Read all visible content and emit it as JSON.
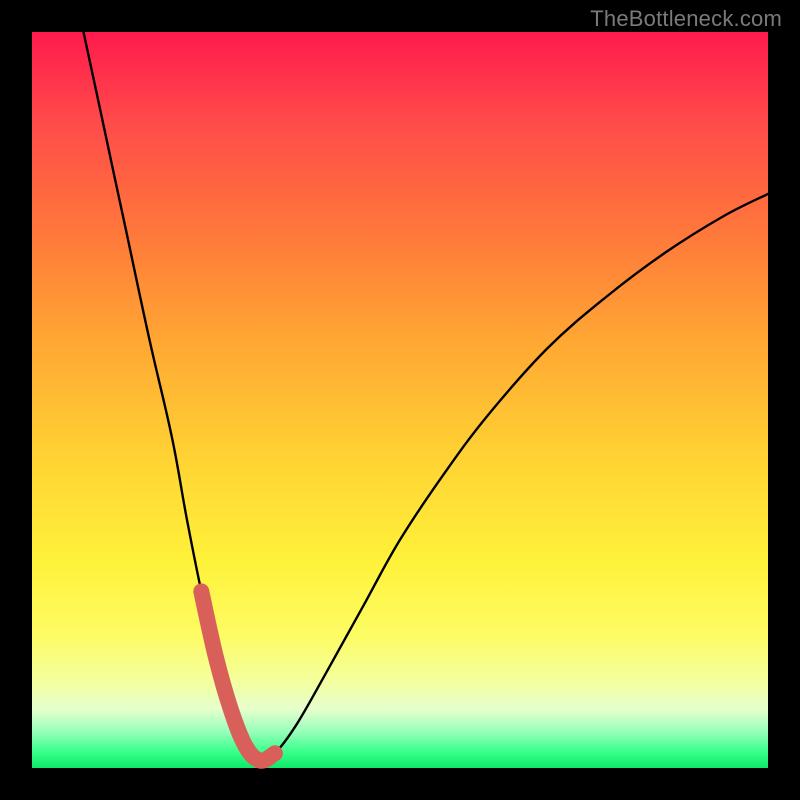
{
  "watermark": "TheBottleneck.com",
  "chart_data": {
    "type": "line",
    "title": "",
    "xlabel": "",
    "ylabel": "",
    "xlim": [
      0,
      100
    ],
    "ylim": [
      0,
      100
    ],
    "series": [
      {
        "name": "bottleneck-curve",
        "x": [
          7,
          10,
          13,
          16,
          19,
          21,
          23,
          25,
          27,
          29,
          31,
          33,
          36,
          40,
          45,
          50,
          56,
          62,
          70,
          78,
          86,
          94,
          100
        ],
        "values": [
          100,
          86,
          72,
          58,
          45,
          34,
          24,
          15,
          8,
          3,
          1,
          2,
          6,
          13,
          22,
          31,
          40,
          48,
          57,
          64,
          70,
          75,
          78
        ]
      },
      {
        "name": "highlight-segment",
        "x": [
          23,
          25,
          27,
          29,
          31,
          33
        ],
        "values": [
          24,
          15,
          8,
          3,
          1,
          2
        ]
      }
    ],
    "colors": {
      "curve": "#000000",
      "highlight": "#d9605a"
    }
  }
}
